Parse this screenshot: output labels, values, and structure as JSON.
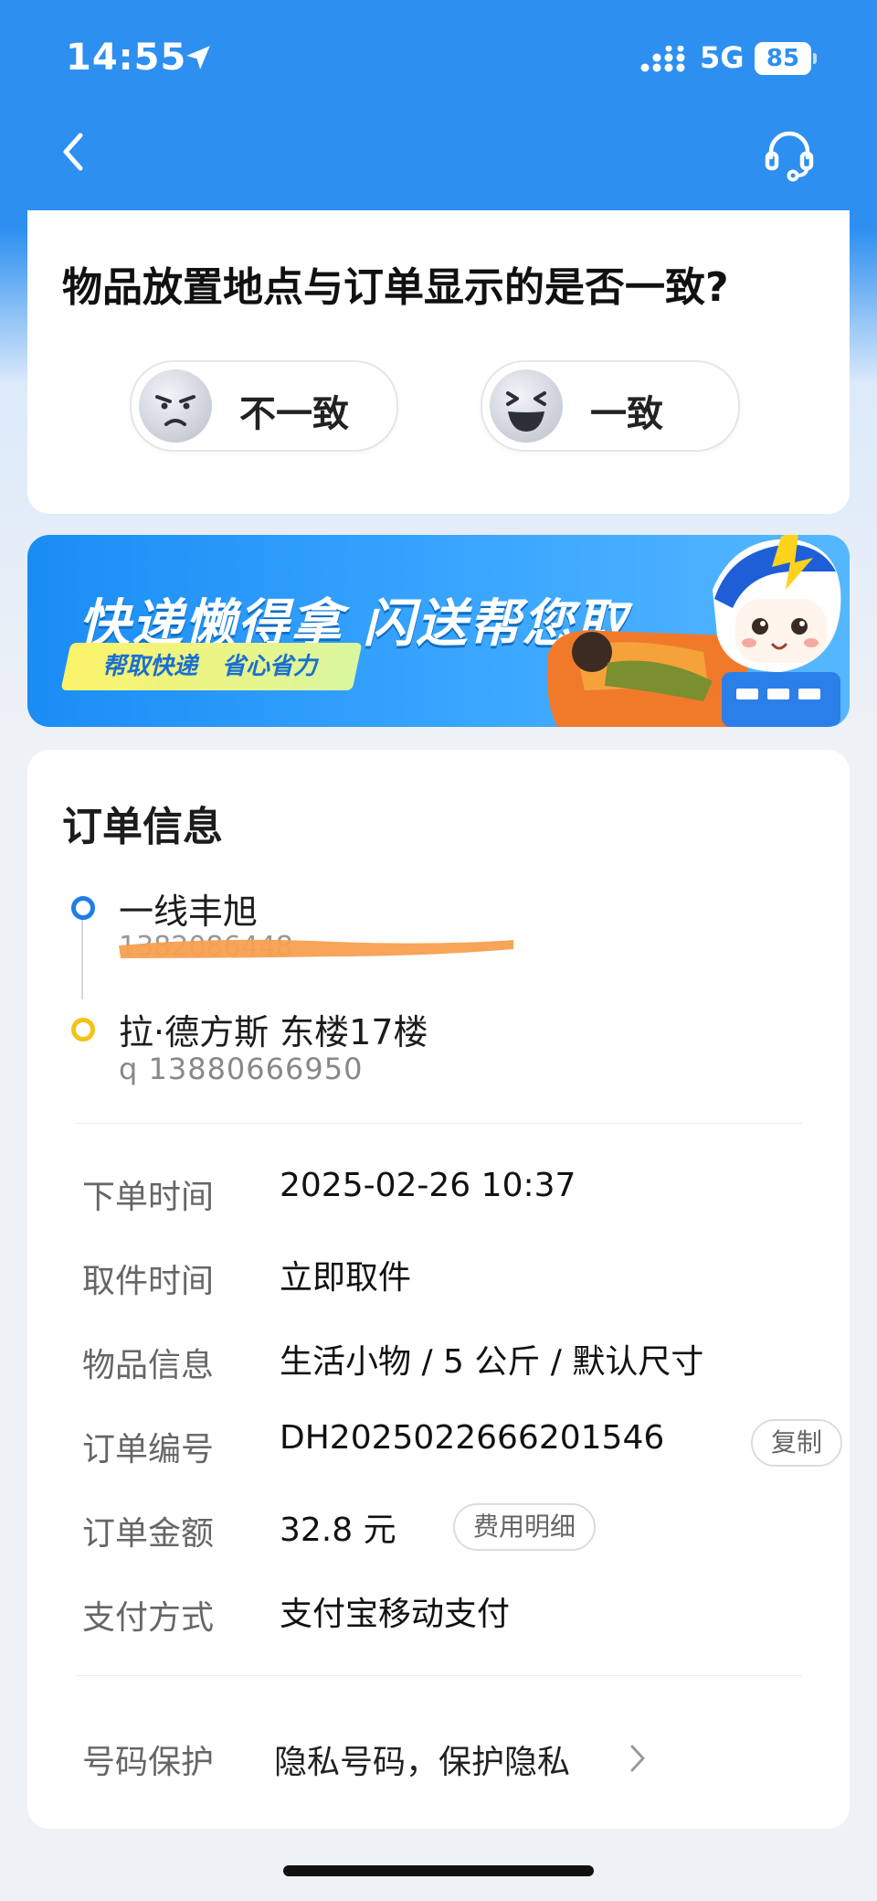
{
  "status_bar": {
    "time": "14:55",
    "network": "5G",
    "battery": "85"
  },
  "nav": {
    "back_icon": "chevron-left-icon",
    "support_icon": "headset-icon"
  },
  "feedback": {
    "question": "物品放置地点与订单显示的是否一致?",
    "options": [
      {
        "label": "不一致",
        "icon": "angry-face-icon"
      },
      {
        "label": "一致",
        "icon": "laughing-face-icon"
      }
    ]
  },
  "banner": {
    "headline": "快递懒得拿 闪送帮您取",
    "tags": [
      "帮取快递",
      "省心省力"
    ]
  },
  "order": {
    "title": "订单信息",
    "sender": {
      "name": "一线丰旭",
      "phone": "1382086448"
    },
    "receiver": {
      "address": "拉·德方斯 东楼17楼",
      "phone": "q  13880666950"
    },
    "rows": [
      {
        "label": "下单时间",
        "value": "2025-02-26 10:37"
      },
      {
        "label": "取件时间",
        "value": "立即取件"
      },
      {
        "label": "物品信息",
        "value": "生活小物 / 5 公斤 / 默认尺寸"
      },
      {
        "label": "订单编号",
        "value": "DH2025022666201546",
        "action": "复制"
      },
      {
        "label": "订单金额",
        "value": "32.8 元",
        "action": "费用明细"
      },
      {
        "label": "支付方式",
        "value": "支付宝移动支付"
      }
    ],
    "privacy": {
      "label": "号码保护",
      "value": "隐私号码，保护隐私"
    }
  },
  "colors": {
    "header_blue": "#2d8ff0",
    "start_dot": "#1e7fe6",
    "end_dot": "#f3c318",
    "redaction": "#f5a050"
  }
}
